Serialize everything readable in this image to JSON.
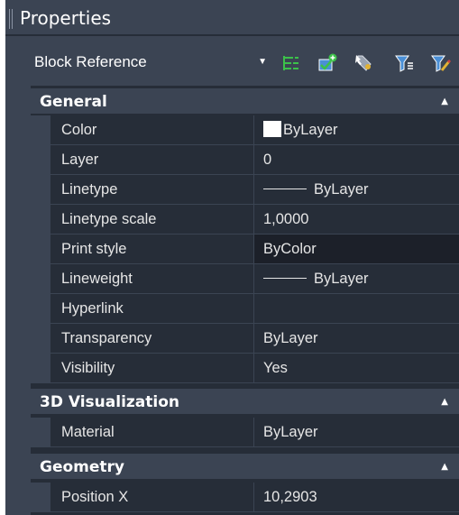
{
  "panel": {
    "title": "Properties"
  },
  "toolbar": {
    "object_type": "Block Reference",
    "icons": [
      "toggle-pickadd-icon",
      "select-objects-icon",
      "quick-select-icon",
      "filter-icon",
      "filter-settings-icon"
    ]
  },
  "sections": {
    "general": {
      "label": "General",
      "rows": [
        {
          "name": "Color",
          "value": "ByLayer"
        },
        {
          "name": "Layer",
          "value": "0"
        },
        {
          "name": "Linetype",
          "value": "ByLayer"
        },
        {
          "name": "Linetype scale",
          "value": "1,0000"
        },
        {
          "name": "Print style",
          "value": "ByColor"
        },
        {
          "name": "Lineweight",
          "value": "ByLayer"
        },
        {
          "name": "Hyperlink",
          "value": ""
        },
        {
          "name": "Transparency",
          "value": "ByLayer"
        },
        {
          "name": "Visibility",
          "value": "Yes"
        }
      ]
    },
    "visualization": {
      "label": "3D Visualization",
      "rows": [
        {
          "name": "Material",
          "value": "ByLayer"
        }
      ]
    },
    "geometry": {
      "label": "Geometry",
      "rows": [
        {
          "name": "Position X",
          "value": "10,2903"
        }
      ]
    }
  },
  "colors": {
    "panel_bg": "#3b4453",
    "grid_bg": "#262d38",
    "selected_value_bg": "#1c2029",
    "swatch": "#ffffff"
  }
}
